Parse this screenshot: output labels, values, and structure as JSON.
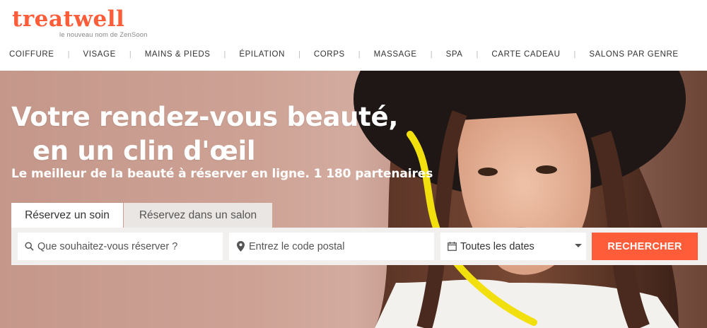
{
  "brand": {
    "logo_text": "treatwell",
    "tagline": "le nouveau nom de ZenSoon",
    "accent_color": "#ff5c39"
  },
  "nav": {
    "items": [
      {
        "label": "COIFFURE"
      },
      {
        "label": "VISAGE"
      },
      {
        "label": "MAINS & PIEDS"
      },
      {
        "label": "ÉPILATION"
      },
      {
        "label": "CORPS"
      },
      {
        "label": "MASSAGE"
      },
      {
        "label": "SPA"
      },
      {
        "label": "CARTE CADEAU"
      },
      {
        "label": "SALONS PAR GENRE"
      }
    ],
    "separator": "|"
  },
  "hero": {
    "headline_line1": "Votre rendez-vous beauté,",
    "headline_line2": "en un clin d'œil",
    "subtitle": "Le meilleur de la beauté à réserver en ligne. 1 180 partenaires"
  },
  "booking": {
    "tabs": [
      {
        "label": "Réservez un soin",
        "active": true
      },
      {
        "label": "Réservez dans un salon",
        "active": false
      }
    ],
    "what_placeholder": "Que souhaitez-vous réserver ?",
    "where_placeholder": "Entrez le code postal",
    "date_value": "Toutes les dates",
    "search_button": "RECHERCHER",
    "icons": {
      "what": "search-icon",
      "where": "location-pin-icon",
      "date": "calendar-icon",
      "dropdown": "chevron-down-icon"
    }
  }
}
